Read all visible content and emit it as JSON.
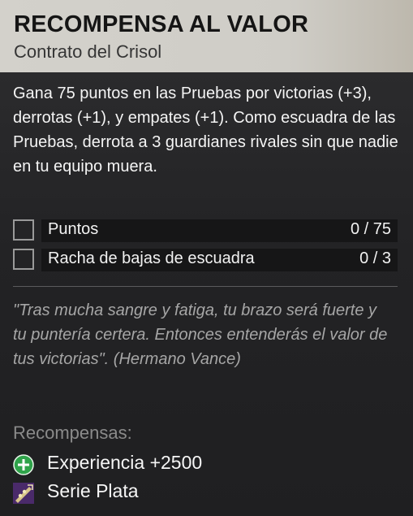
{
  "header": {
    "title": "RECOMPENSA AL VALOR",
    "subtitle": "Contrato del Crisol"
  },
  "description": "Gana 75 puntos en las Pruebas por victorias (+3), derrotas (+1), y empates (+1). Como escuadra de las Pruebas, derrota a 3 guardianes rivales sin que nadie en tu equipo muera.",
  "objectives": [
    {
      "label": "Puntos",
      "value": "0 / 75"
    },
    {
      "label": "Racha de bajas de escuadra",
      "value": "0 / 3"
    }
  ],
  "lore": "\"Tras mucha sangre y fatiga, tu brazo será fuerte y tu puntería certera. Entonces entenderás el valor de tus victorias\". (Hermano Vance)",
  "rewards": {
    "heading": "Recompensas:",
    "items": [
      {
        "icon": "xp-plus-icon",
        "label": "Experiencia  +2500"
      },
      {
        "icon": "silver-series-icon",
        "label": "Serie Plata"
      }
    ]
  },
  "colors": {
    "header_bg": "#d3d1cb",
    "body_bg": "#202022",
    "xp_icon_green": "#2fa34a",
    "series_icon": "#4a2a6a"
  }
}
